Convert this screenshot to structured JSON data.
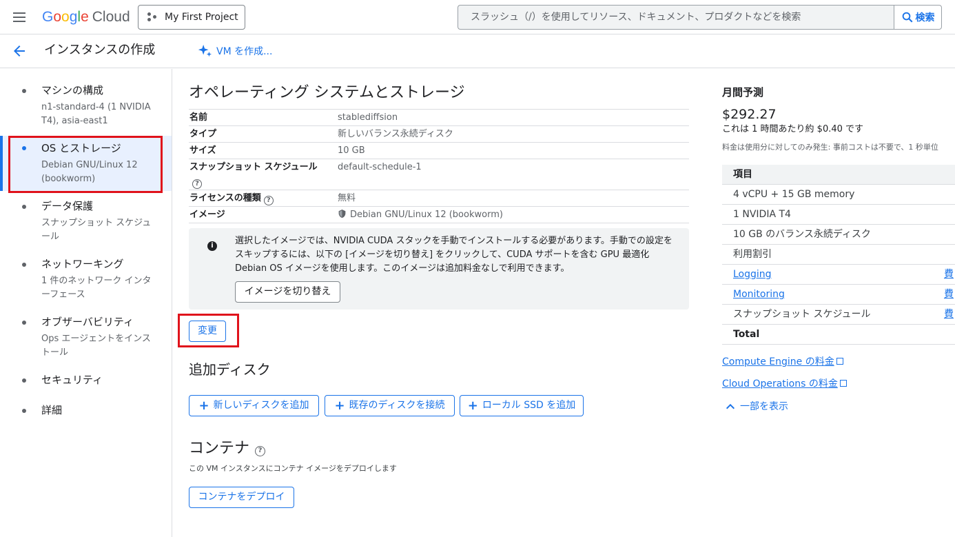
{
  "topbar": {
    "logo_google": [
      "G",
      "o",
      "o",
      "g",
      "l",
      "e"
    ],
    "logo_cloud": "Cloud",
    "project_name": "My First Project",
    "search_placeholder": "スラッシュ（/）を使用してリソース、ドキュメント、プロダクトなどを検索",
    "search_button": "検索"
  },
  "header": {
    "title": "インスタンスの作成",
    "vm_create_label": "VM を作成..."
  },
  "sidebar": {
    "items": [
      {
        "label": "マシンの構成",
        "sub": "n1-standard-4 (1 NVIDIA T4), asia-east1"
      },
      {
        "label": "OS とストレージ",
        "sub": "Debian GNU/Linux 12 (bookworm)"
      },
      {
        "label": "データ保護",
        "sub": "スナップショット スケジュール"
      },
      {
        "label": "ネットワーキング",
        "sub": "1 件のネットワーク インターフェース"
      },
      {
        "label": "オブザーバビリティ",
        "sub": "Ops エージェントをインストール"
      },
      {
        "label": "セキュリティ",
        "sub": ""
      },
      {
        "label": "詳細",
        "sub": ""
      }
    ]
  },
  "os_storage": {
    "title": "オペレーティング システムとストレージ",
    "rows": [
      {
        "key": "名前",
        "value": "stablediffsion"
      },
      {
        "key": "タイプ",
        "value": "新しいバランス永続ディスク"
      },
      {
        "key": "サイズ",
        "value": "10 GB"
      },
      {
        "key": "スナップショット スケジュール",
        "value": "default-schedule-1"
      },
      {
        "key": "ライセンスの種類",
        "value": "無料"
      },
      {
        "key": "イメージ",
        "value": "Debian GNU/Linux 12 (bookworm)"
      }
    ],
    "info_text": "選択したイメージでは、NVIDIA CUDA スタックを手動でインストールする必要があります。手動での設定をスキップするには、以下の [イメージを切り替え] をクリックして、CUDA サポートを含む GPU 最適化 Debian OS イメージを使用します。このイメージは追加料金なしで利用できます。",
    "switch_image_button": "イメージを切り替え",
    "change_button": "変更"
  },
  "additional_disk": {
    "title": "追加ディスク",
    "buttons": [
      "新しいディスクを追加",
      "既存のディスクを接続",
      "ローカル SSD を追加"
    ]
  },
  "container": {
    "title": "コンテナ",
    "description": "この VM インスタンスにコンテナ イメージをデプロイします",
    "deploy_button": "コンテナをデプロイ"
  },
  "estimate": {
    "title": "月間予測",
    "price": "$292.27",
    "hourly": "これは 1 時間あたり約 $0.40 です",
    "note": "料金は使用分に対してのみ発生: 事前コストは不要で、1 秒単位",
    "table_header": "項目",
    "items": [
      {
        "label": "4 vCPU + 15 GB memory",
        "link": false,
        "right": ""
      },
      {
        "label": "1 NVIDIA T4",
        "link": false,
        "right": ""
      },
      {
        "label": "10 GB のバランス永続ディスク",
        "link": false,
        "right": ""
      },
      {
        "label": "利用割引",
        "link": false,
        "right": ""
      },
      {
        "label": "Logging",
        "link": true,
        "right": "費"
      },
      {
        "label": "Monitoring",
        "link": true,
        "right": "費"
      },
      {
        "label": "スナップショット スケジュール",
        "link": false,
        "right": "費"
      }
    ],
    "total_label": "Total",
    "links": [
      "Compute Engine の料金",
      "Cloud Operations の料金"
    ],
    "show_less": "一部を表示"
  },
  "colors": {
    "accent": "#1a73e8",
    "highlight_box": "#e0121b",
    "active_nav_bg": "#e8f0fe"
  }
}
